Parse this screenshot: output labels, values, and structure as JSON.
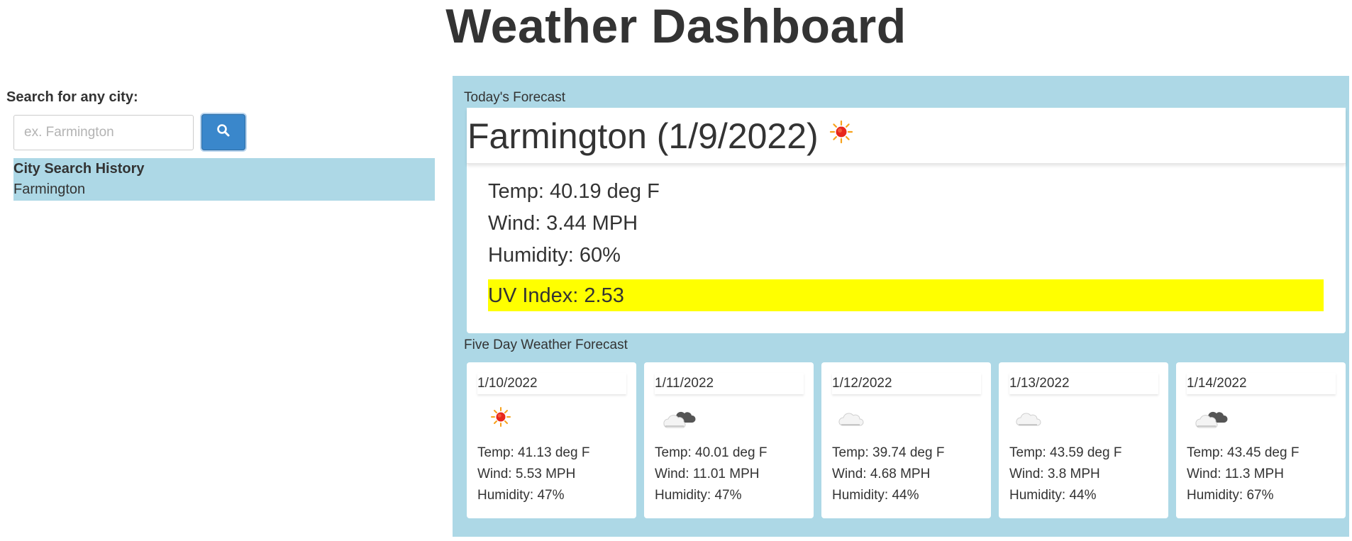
{
  "header": {
    "title": "Weather Dashboard"
  },
  "sidebar": {
    "search_label": "Search for any city:",
    "search_placeholder": "ex. Farmington",
    "search_value": "",
    "search_button_icon": "search-icon",
    "history_title": "City Search History",
    "history_items": [
      "Farmington"
    ]
  },
  "today": {
    "section_label": "Today's Forecast",
    "city_title": "Farmington (1/9/2022)",
    "icon": "sun-icon",
    "temp": "Temp: 40.19 deg F",
    "wind": "Wind: 3.44 MPH",
    "humidity": "Humidity: 60%",
    "uv": "UV Index: 2.53",
    "uv_color": "#ffff00"
  },
  "forecast": {
    "section_label": "Five Day Weather Forecast",
    "days": [
      {
        "date": "1/10/2022",
        "icon": "sun-icon",
        "temp": "Temp: 41.13 deg F",
        "wind": "Wind: 5.53 MPH",
        "humidity": "Humidity: 47%"
      },
      {
        "date": "1/11/2022",
        "icon": "dark-clouds-icon",
        "temp": "Temp: 40.01 deg F",
        "wind": "Wind: 11.01 MPH",
        "humidity": "Humidity: 47%"
      },
      {
        "date": "1/12/2022",
        "icon": "cloud-icon",
        "temp": "Temp: 39.74 deg F",
        "wind": "Wind: 4.68 MPH",
        "humidity": "Humidity: 44%"
      },
      {
        "date": "1/13/2022",
        "icon": "cloud-icon",
        "temp": "Temp: 43.59 deg F",
        "wind": "Wind: 3.8 MPH",
        "humidity": "Humidity: 44%"
      },
      {
        "date": "1/14/2022",
        "icon": "dark-clouds-icon",
        "temp": "Temp: 43.45 deg F",
        "wind": "Wind: 11.3 MPH",
        "humidity": "Humidity: 67%"
      }
    ]
  },
  "colors": {
    "panel_background": "#add8e6",
    "search_button": "#3a87cb",
    "text": "#333333"
  }
}
